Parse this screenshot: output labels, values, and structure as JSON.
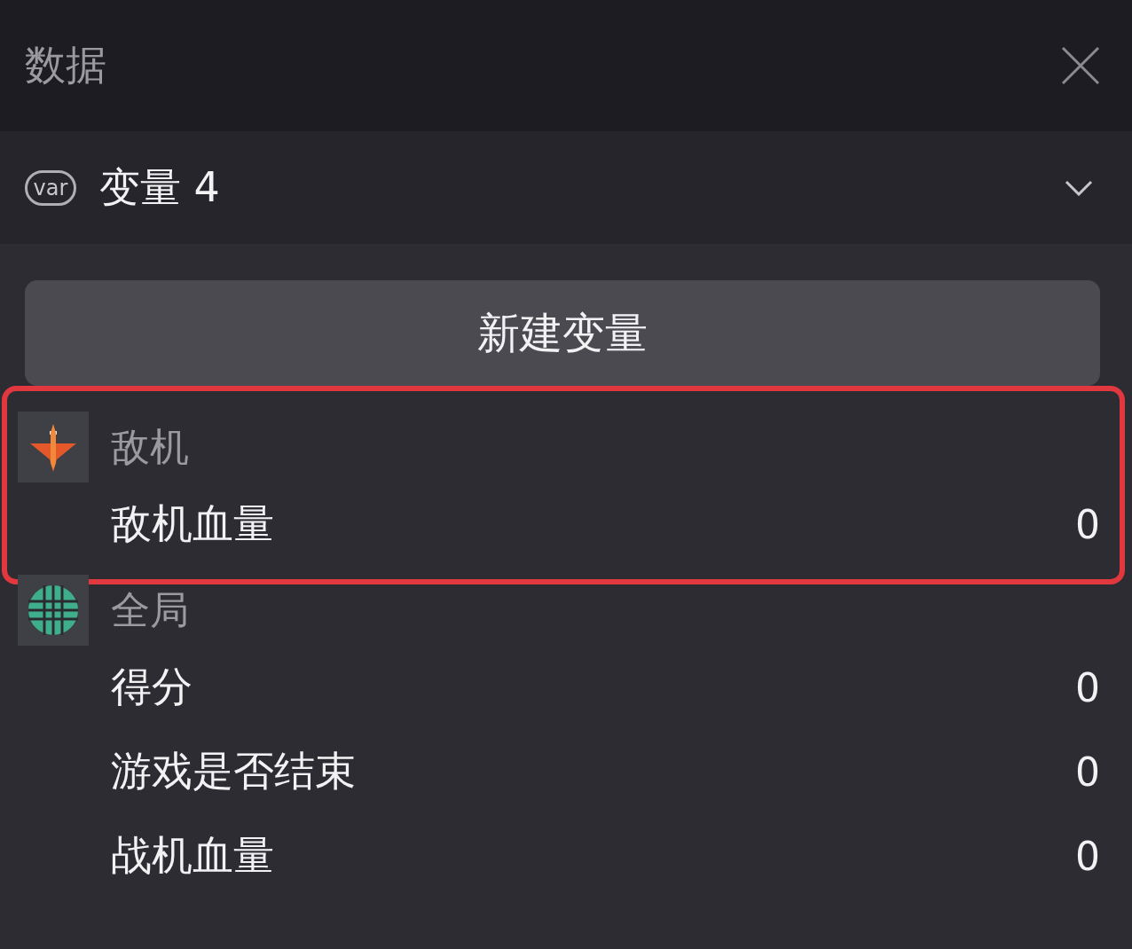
{
  "header": {
    "title": "数据"
  },
  "selector": {
    "badge": "var",
    "label": "变量 4"
  },
  "new_button": {
    "label": "新建变量"
  },
  "groups": [
    {
      "name": "敌机",
      "kind": "plane",
      "highlighted": true,
      "variables": [
        {
          "name": "敌机血量",
          "value": "0"
        }
      ]
    },
    {
      "name": "全局",
      "kind": "globe",
      "highlighted": false,
      "variables": [
        {
          "name": "得分",
          "value": "0"
        },
        {
          "name": "游戏是否结束",
          "value": "0"
        },
        {
          "name": "战机血量",
          "value": "0"
        }
      ]
    }
  ]
}
